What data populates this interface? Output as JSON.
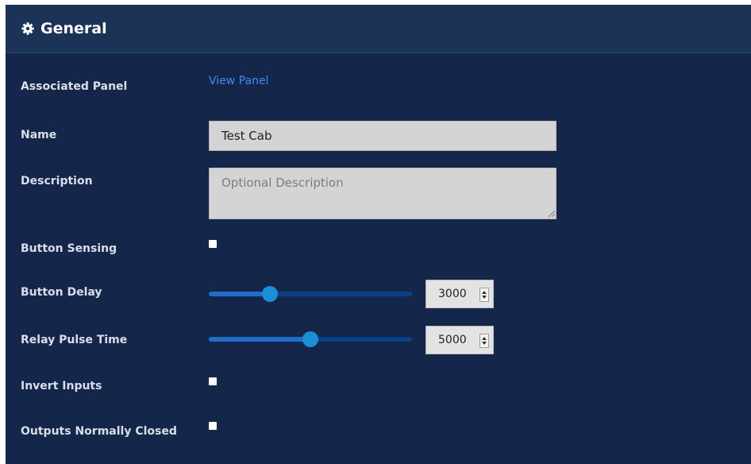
{
  "header": {
    "title": "General",
    "icon": "gear-icon"
  },
  "associated_panel": {
    "label": "Associated Panel",
    "link_text": "View Panel"
  },
  "name": {
    "label": "Name",
    "value": "Test Cab"
  },
  "description": {
    "label": "Description",
    "value": "",
    "placeholder": "Optional Description"
  },
  "button_sensing": {
    "label": "Button Sensing",
    "checked": false
  },
  "button_delay": {
    "label": "Button Delay",
    "value": "3000",
    "slider_fraction": 0.3
  },
  "relay_pulse_time": {
    "label": "Relay Pulse Time",
    "value": "5000",
    "slider_fraction": 0.5
  },
  "invert_inputs": {
    "label": "Invert Inputs",
    "checked": false
  },
  "outputs_normally_closed": {
    "label": "Outputs Normally Closed",
    "checked": false
  },
  "colors": {
    "panel_background": "#14274a",
    "header_background": "#1c3358",
    "link": "#3d8df5",
    "slider_track": "#0b3f86",
    "slider_thumb": "#1a8fd6"
  }
}
